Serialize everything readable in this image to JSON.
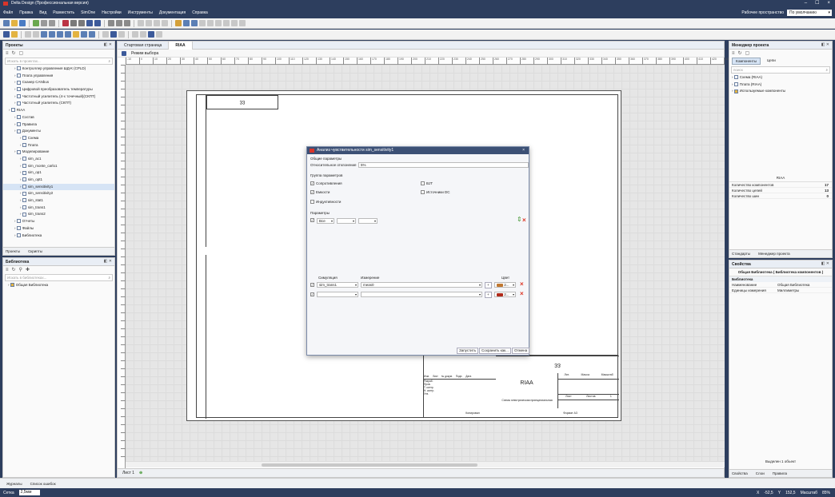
{
  "window": {
    "title": "Delta Design (Профессиональная версия)",
    "controls": [
      "–",
      "☐",
      "×"
    ]
  },
  "menu": [
    "Файл",
    "Правка",
    "Вид",
    "Разместить",
    "SimOne",
    "Настройки",
    "Инструменты",
    "Документация",
    "Справка"
  ],
  "workspace": {
    "label": "Рабочее пространство",
    "value": "По умолчанию"
  },
  "projects_panel": {
    "title": "Проекты",
    "search_placeholder": "Искать в проектах...",
    "items": [
      {
        "label": "Контроллер управления ШД-К (CPLD)",
        "level": 2
      },
      {
        "label": "Плата управления",
        "level": 2
      },
      {
        "label": "Сканер CANbus",
        "level": 2
      },
      {
        "label": "Цифровой преобразователь температуры",
        "level": 2
      },
      {
        "label": "Частотный усилитель (4-х точечный)(СКПТ)",
        "level": 2
      },
      {
        "label": "Частотный усилитель (СКПТ)",
        "level": 2
      },
      {
        "label": "RIAA",
        "level": 1
      },
      {
        "label": "Состав",
        "level": 2
      },
      {
        "label": "Правила",
        "level": 2
      },
      {
        "label": "Документы",
        "level": 2
      },
      {
        "label": "Схема",
        "level": 3
      },
      {
        "label": "Плата",
        "level": 3
      },
      {
        "label": "Моделирование",
        "level": 2
      },
      {
        "label": "sim_ac1",
        "level": 3
      },
      {
        "label": "sim_monte_carlo1",
        "level": 3
      },
      {
        "label": "sim_op1",
        "level": 3
      },
      {
        "label": "sim_opt1",
        "level": 3
      },
      {
        "label": "sim_sensitivity1",
        "level": 3,
        "selected": true
      },
      {
        "label": "sim_sensitivity2",
        "level": 3
      },
      {
        "label": "sim_stat1",
        "level": 3
      },
      {
        "label": "sim_trans1",
        "level": 3
      },
      {
        "label": "sim_trans2",
        "level": 3
      },
      {
        "label": "Отчеты",
        "level": 2
      },
      {
        "label": "Файлы",
        "level": 2
      },
      {
        "label": "Библиотека",
        "level": 2
      }
    ],
    "tabs": [
      "Проекты",
      "Скрипты"
    ]
  },
  "library_panel": {
    "title": "Библиотека",
    "search_placeholder": "Искать в библиотеках...",
    "items": [
      "Общая Библиотека"
    ]
  },
  "doc_tabs": [
    "Стартовая страница",
    "RIAA"
  ],
  "subbar": {
    "mode": "Режим выбора"
  },
  "ruler": [
    "-10",
    "0",
    "10",
    "20",
    "30",
    "40",
    "50",
    "60",
    "70",
    "80",
    "90",
    "100",
    "110",
    "120",
    "130",
    "140",
    "150",
    "160",
    "170",
    "180",
    "190",
    "200",
    "210",
    "220",
    "230",
    "240",
    "250",
    "260",
    "270",
    "280",
    "290",
    "300",
    "310",
    "320",
    "330",
    "340",
    "350",
    "360",
    "370",
    "380",
    "390",
    "400",
    "410",
    "420",
    "430"
  ],
  "sheet": {
    "corner_code": "33",
    "stamp_code": "33",
    "stamp_title": "RIAA",
    "stamp_subtitle": "Схема электрическая принципиальная",
    "stamp_cols": [
      "Лит.",
      "Масса",
      "Масштаб"
    ],
    "stamp_sheet": [
      "Лист",
      "Листов",
      "1"
    ],
    "stamp_rows": [
      "Изм.",
      "Лист",
      "№ докум.",
      "Подп.",
      "Дата",
      "Разраб.",
      "Пров.",
      "Т. контр.",
      "Н. контр.",
      "Утв."
    ],
    "footer_left": "Копировал",
    "footer_right": "Формат A3",
    "left_labels": [
      "Перв. примен.",
      "Справ. №",
      "Подп. и дата",
      "Инв. № дубл.",
      "Взам. инв. №",
      "Подп. и дата",
      "Инв. № подл."
    ]
  },
  "sheet_tab": {
    "label": "Лист 1"
  },
  "dialog": {
    "title": "Анализ чувствительности sim_sensitivity1",
    "general_section": "Общие параметры",
    "relative_label": "Относительное отклонение",
    "relative_value": "5%",
    "group_section": "Группа параметров",
    "checks": [
      {
        "label": "Сопротивления",
        "checked": true
      },
      {
        "label": "BJT",
        "checked": false
      },
      {
        "label": "Емкости",
        "checked": true
      },
      {
        "label": "Источники DC",
        "checked": false
      },
      {
        "label": "Индуктивности",
        "checked": false
      }
    ],
    "params_section": "Параметры",
    "param_row": {
      "value": "Все"
    },
    "cols": {
      "sim": "Симуляция",
      "meas": "Измерение",
      "color": "Цвет"
    },
    "rows": [
      {
        "sim": "sim_trans1",
        "meas": "meas0",
        "color": "#c07832",
        "color_text": "2..."
      },
      {
        "sim": "",
        "meas": "",
        "color": "#b02a1a",
        "color_text": "2..."
      }
    ],
    "buttons": [
      "Запустить",
      "Сохранить как...",
      "Отмена"
    ]
  },
  "project_manager": {
    "title": "Менеджер проекта",
    "tabs": [
      "Компоненты",
      "Цепи"
    ],
    "search_placeholder": "поиск",
    "items": [
      "Схема (RIAA)",
      "Плата (RIAA)",
      "Используемые компоненты"
    ],
    "info_title": "RIAA",
    "info": [
      {
        "label": "Количество компонентов",
        "value": "17"
      },
      {
        "label": "Количество цепей",
        "value": "13"
      },
      {
        "label": "Количество шин",
        "value": "0"
      }
    ],
    "bottom_tabs": [
      "Стандарты",
      "Менеджер проекта"
    ]
  },
  "properties": {
    "title": "Свойства",
    "subtitle": "Общая Библиотека ( Библиотека компонентов )",
    "group": "Библиотека",
    "rows": [
      {
        "label": "Наименование",
        "value": "Общая Библиотека"
      },
      {
        "label": "Единицы измерения",
        "value": "Миллиметры"
      }
    ],
    "selected_text": "Выделен 1 объект",
    "bottom_tabs": [
      "Свойства",
      "Слои",
      "Правила"
    ]
  },
  "bottom_bar": [
    "Журналы",
    "Список ошибок"
  ],
  "status": {
    "grid_label": "Сетка",
    "grid_value": "2,5мм",
    "x_label": "X",
    "x_value": "-52,5",
    "y_label": "Y",
    "y_value": "152,5",
    "scale_label": "Масштаб",
    "scale_value": "85%"
  }
}
